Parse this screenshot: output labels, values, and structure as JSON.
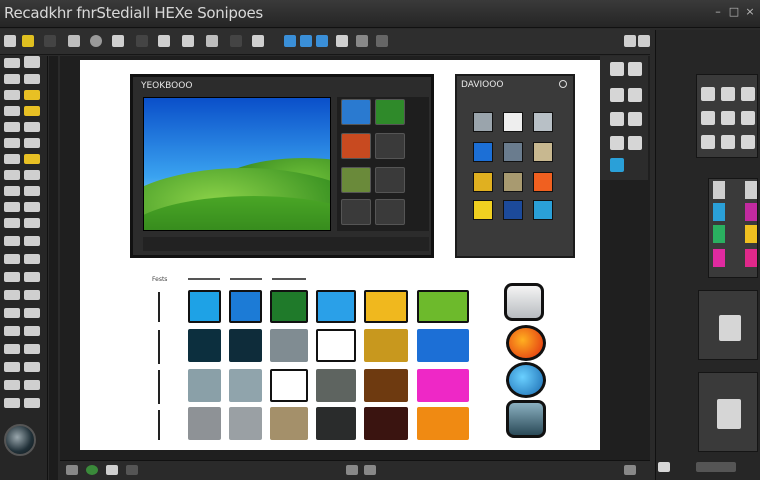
{
  "window": {
    "title": "Recadkhr fnrStediall HEXe Sonipoes"
  },
  "preview": {
    "title": "YEOKBOOO"
  },
  "swatch_panel": {
    "title": "DAVIOOO"
  },
  "grid": {
    "label": "Fests",
    "rows": [
      [
        "#1ea2e6",
        "#1c7bd6",
        "#1f7a2a",
        "#2aa0e8",
        "#f0b81e",
        "#6dba2c"
      ],
      [
        "#0c2f3e",
        "#0e2c3a",
        "#808c92",
        "#ffffff",
        "#c8981e",
        "#1c6fd6"
      ],
      [
        "#8aa0a8",
        "#90a4ac",
        "#ffffff",
        "#5e6460",
        "#6e3a10",
        "#ee28c6"
      ],
      [
        "#8e9296",
        "#9aa0a4",
        "#a4906a",
        "#2a2c2c",
        "#3a1410",
        "#f08a12"
      ]
    ]
  },
  "colors": {
    "background": "#2a2a2a",
    "document": "#ffffff",
    "accent_blue": "#1ea2e6"
  },
  "icons": [
    "close-icon",
    "minimize-icon",
    "maximize-icon",
    "navigation-knob-icon",
    "circle-button-icon",
    "diamond-button-icon"
  ]
}
